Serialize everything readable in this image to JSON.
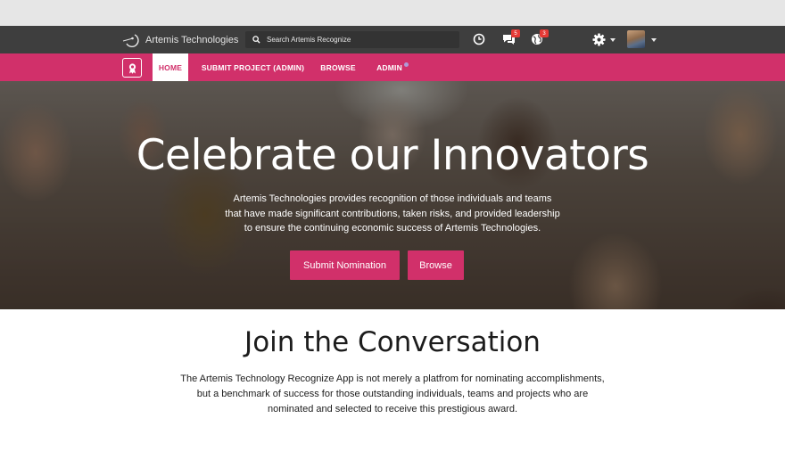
{
  "header": {
    "brand": "Artemis Technologies",
    "search_placeholder": "Search Artemis Recognize",
    "icons": [
      "clock-icon",
      "chat-icon",
      "globe-icon",
      "gear-icon"
    ],
    "chat_badge": "5",
    "globe_badge": "3"
  },
  "nav": {
    "items": [
      {
        "label": "HOME",
        "active": true
      },
      {
        "label": "SUBMIT PROJECT (ADMIN)",
        "active": false
      },
      {
        "label": "BROWSE",
        "active": false
      },
      {
        "label": "ADMIN",
        "active": false
      }
    ]
  },
  "hero": {
    "title": "Celebrate our Innovators",
    "lines": [
      "Artemis Technologies provides recognition of those individuals and teams",
      "that have made significant contributions, taken risks, and provided leadership",
      "to ensure the continuing economic success of Artemis Technologies."
    ],
    "primary_button": "Submit Nomination",
    "secondary_button": "Browse"
  },
  "join": {
    "title": "Join the Conversation",
    "lines": [
      "The Artemis Technology Recognize App is not merely a platfrom for nominating accomplishments,",
      "but a benchmark of success for those outstanding individuals, teams and projects who are",
      "nominated and selected to receive this prestigious award."
    ]
  },
  "colors": {
    "topbar": "#3e3e3e",
    "accent": "#d1306a",
    "badge": "#e53935"
  }
}
